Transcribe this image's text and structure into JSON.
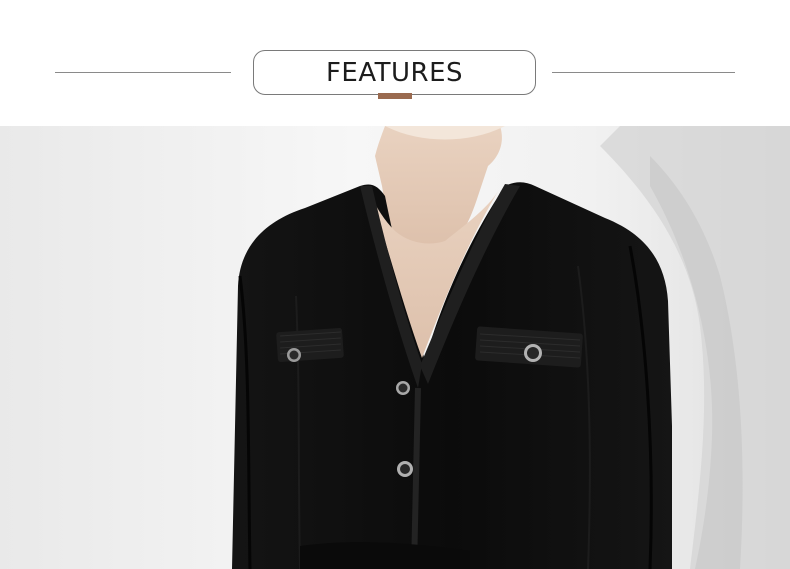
{
  "header": {
    "title": "FEATURES",
    "accent_color": "#9a6a4f"
  },
  "photo": {
    "icon": "product-photo-black-knit-cardigan"
  }
}
